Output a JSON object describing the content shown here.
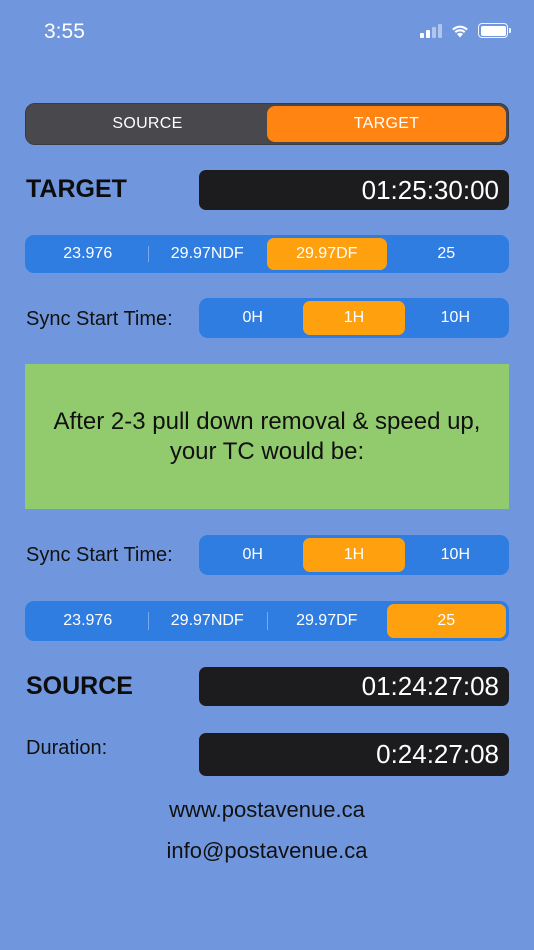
{
  "status_bar": {
    "time": "3:55",
    "icons": [
      "cellular-signal-icon",
      "wifi-icon",
      "battery-icon"
    ]
  },
  "mode_toggle": {
    "options": [
      "SOURCE",
      "TARGET"
    ],
    "selected": "TARGET"
  },
  "target": {
    "heading": "TARGET",
    "timecode": "01:25:30:00",
    "frame_rates": [
      "23.976",
      "29.97NDF",
      "29.97DF",
      "25"
    ],
    "selected_frame_rate": "29.97DF",
    "sync_label": "Sync Start Time:",
    "sync_options": [
      "0H",
      "1H",
      "10H"
    ],
    "selected_sync": "1H"
  },
  "info_message": "After 2-3 pull down removal & speed up, your TC would be:",
  "source": {
    "sync_label": "Sync Start Time:",
    "sync_options": [
      "0H",
      "1H",
      "10H"
    ],
    "selected_sync": "1H",
    "frame_rates": [
      "23.976",
      "29.97NDF",
      "29.97DF",
      "25"
    ],
    "selected_frame_rate": "25",
    "heading": "SOURCE",
    "timecode": "01:24:27:08"
  },
  "duration": {
    "label": "Duration:",
    "value": "0:24:27:08"
  },
  "links": {
    "website": "www.postavenue.ca",
    "email": "info@postavenue.ca"
  },
  "colors": {
    "background": "#7097dd",
    "segment_blue": "#2f7de1",
    "selected_orange": "#ffa00f",
    "toggle_orange": "#ff8412",
    "toggle_dark": "#48484d",
    "display_dark": "#1c1c1e",
    "info_green": "#92cb6e"
  }
}
